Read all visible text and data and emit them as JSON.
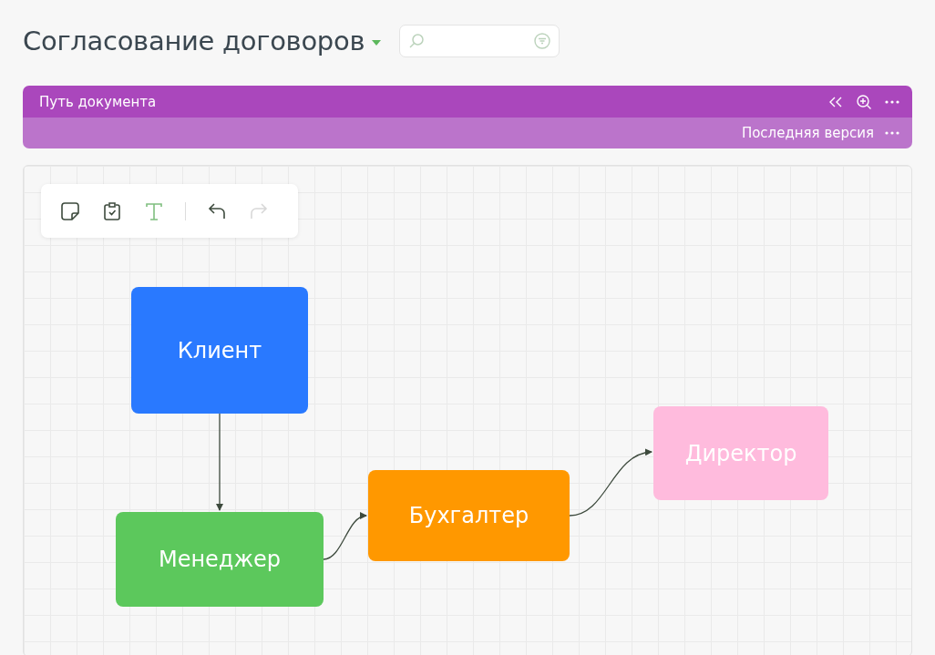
{
  "header": {
    "title": "Согласование договоров"
  },
  "panel": {
    "title": "Путь документа",
    "version": "Последняя версия"
  },
  "toolbar": [
    {
      "kind": "sticker",
      "disabled": false
    },
    {
      "kind": "task",
      "disabled": false
    },
    {
      "kind": "text",
      "disabled": false
    },
    {
      "kind": "undo",
      "disabled": false
    },
    {
      "kind": "redo",
      "disabled": true
    }
  ],
  "nodes": [
    {
      "label": "Клиент",
      "color": "#2979ff"
    },
    {
      "label": "Менеджер",
      "color": "#5cc85c"
    },
    {
      "label": "Бухгалтер",
      "color": "#ff9800"
    },
    {
      "label": "Директор",
      "color": "#ffbbdd"
    }
  ]
}
